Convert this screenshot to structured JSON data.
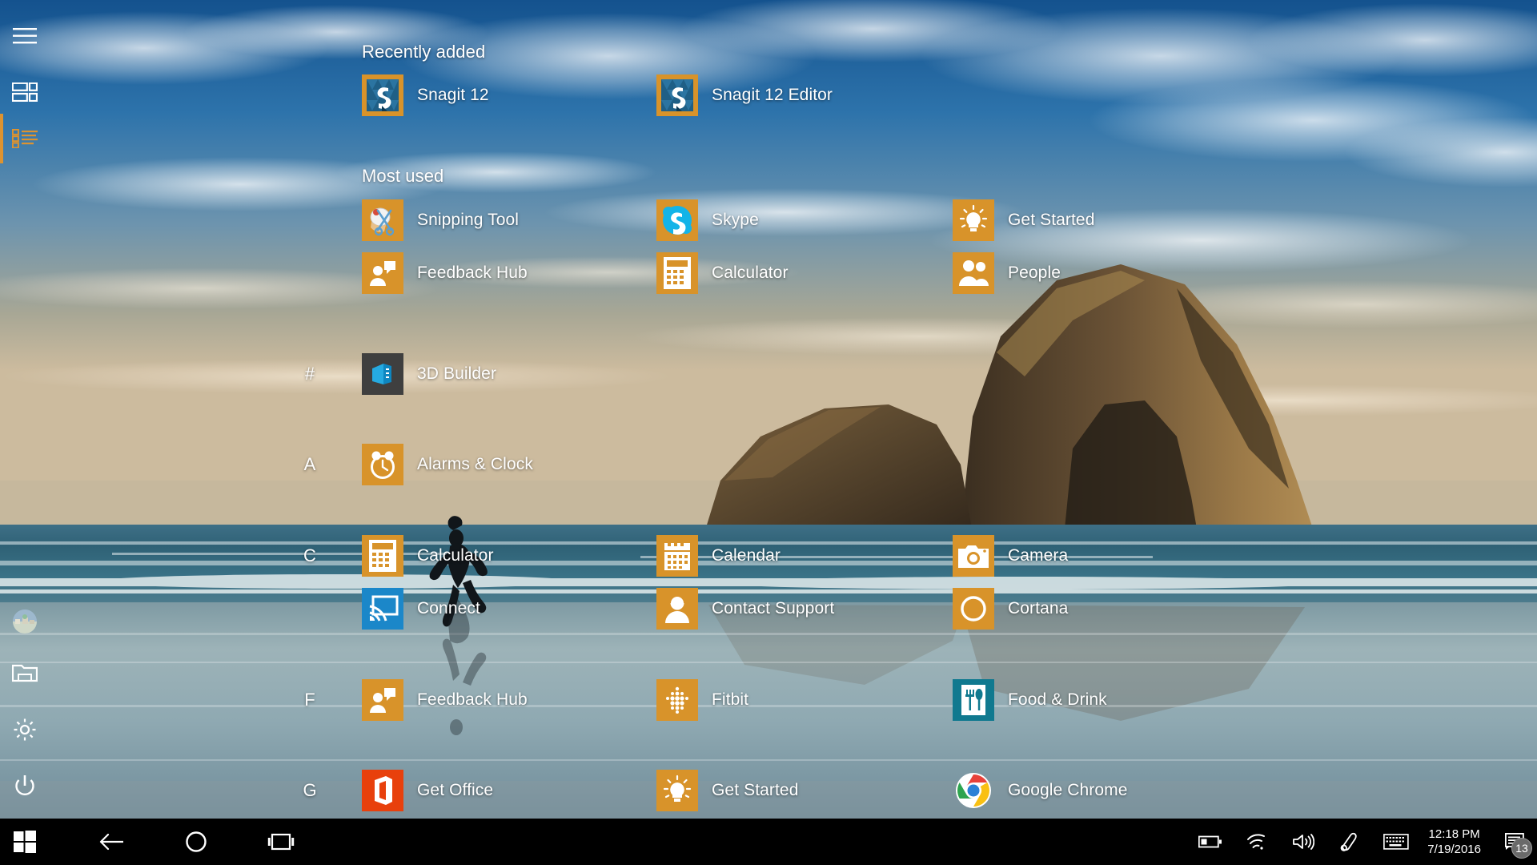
{
  "window": {
    "title": "Windows 10 Start Menu - All apps",
    "accent_color": "#d8932a",
    "taskbar_color": "#000000"
  },
  "left_rail": {
    "items": [
      {
        "name": "hamburger-menu",
        "icon": "hamburger-icon",
        "label": "Menu",
        "selected": false
      },
      {
        "name": "tiles-view",
        "icon": "tiles-icon",
        "label": "Tiles view",
        "selected": false
      },
      {
        "name": "all-apps-list",
        "icon": "list-icon",
        "label": "All apps",
        "selected": true
      },
      {
        "name": "user-account",
        "icon": "avatar-icon",
        "label": "User account",
        "selected": false
      },
      {
        "name": "file-explorer",
        "icon": "folder-icon",
        "label": "File Explorer",
        "selected": false
      },
      {
        "name": "settings",
        "icon": "gear-icon",
        "label": "Settings",
        "selected": false
      },
      {
        "name": "power",
        "icon": "power-icon",
        "label": "Power",
        "selected": false
      }
    ]
  },
  "app_list": {
    "recently_added_header": "Recently added",
    "most_used_header": "Most used",
    "recently_added": [
      {
        "label": "Snagit 12",
        "icon": "snagit-icon",
        "tile_color": "#d8932a"
      },
      {
        "label": "Snagit 12 Editor",
        "icon": "snagit-icon",
        "tile_color": "#d8932a"
      }
    ],
    "most_used": [
      {
        "label": "Snipping Tool",
        "icon": "scissors-icon",
        "tile_color": "#d8932a"
      },
      {
        "label": "Skype",
        "icon": "skype-icon",
        "tile_color": "#d8932a"
      },
      {
        "label": "Get Started",
        "icon": "lightbulb-icon",
        "tile_color": "#d8932a"
      },
      {
        "label": "Feedback Hub",
        "icon": "feedback-icon",
        "tile_color": "#d8932a"
      },
      {
        "label": "Calculator",
        "icon": "calculator-icon",
        "tile_color": "#d8932a"
      },
      {
        "label": "People",
        "icon": "people-icon",
        "tile_color": "#d8932a"
      }
    ],
    "groups": [
      {
        "letter": "#",
        "apps": [
          {
            "label": "3D Builder",
            "icon": "3d-builder-icon",
            "tile_color": "#3f3f3f"
          }
        ]
      },
      {
        "letter": "A",
        "apps": [
          {
            "label": "Alarms & Clock",
            "icon": "alarm-clock-icon",
            "tile_color": "#d8932a"
          }
        ]
      },
      {
        "letter": "C",
        "apps": [
          {
            "label": "Calculator",
            "icon": "calculator-icon",
            "tile_color": "#d8932a"
          },
          {
            "label": "Calendar",
            "icon": "calendar-icon",
            "tile_color": "#d8932a"
          },
          {
            "label": "Camera",
            "icon": "camera-icon",
            "tile_color": "#d8932a"
          },
          {
            "label": "Connect",
            "icon": "cast-icon",
            "tile_color": "#1b87c9"
          },
          {
            "label": "Contact Support",
            "icon": "headset-person-icon",
            "tile_color": "#d8932a"
          },
          {
            "label": "Cortana",
            "icon": "cortana-ring-icon",
            "tile_color": "#d8932a"
          }
        ]
      },
      {
        "letter": "F",
        "apps": [
          {
            "label": "Feedback Hub",
            "icon": "feedback-icon",
            "tile_color": "#d8932a"
          },
          {
            "label": "Fitbit",
            "icon": "fitbit-dots-icon",
            "tile_color": "#d8932a"
          },
          {
            "label": "Food & Drink",
            "icon": "fork-spoon-icon",
            "tile_color": "#10798f"
          }
        ]
      },
      {
        "letter": "G",
        "apps": [
          {
            "label": "Get Office",
            "icon": "office-icon",
            "tile_color": "#e8400c"
          },
          {
            "label": "Get Started",
            "icon": "lightbulb-icon",
            "tile_color": "#d8932a"
          },
          {
            "label": "Google Chrome",
            "icon": "chrome-icon",
            "tile_color": "#ffffff"
          }
        ]
      }
    ]
  },
  "taskbar": {
    "start_button": "Start",
    "back_button": "Back",
    "cortana_button": "Cortana",
    "task_view_button": "Task View",
    "tray": [
      {
        "name": "battery-icon",
        "label": "Battery"
      },
      {
        "name": "wifi-icon",
        "label": "Network"
      },
      {
        "name": "volume-icon",
        "label": "Volume"
      },
      {
        "name": "pen-icon",
        "label": "Windows Ink Workspace"
      },
      {
        "name": "keyboard-icon",
        "label": "Touch keyboard"
      }
    ],
    "clock": {
      "time": "12:18 PM",
      "date": "7/19/2016"
    },
    "action_center": {
      "label": "Action Center",
      "badge_count": "13"
    }
  }
}
